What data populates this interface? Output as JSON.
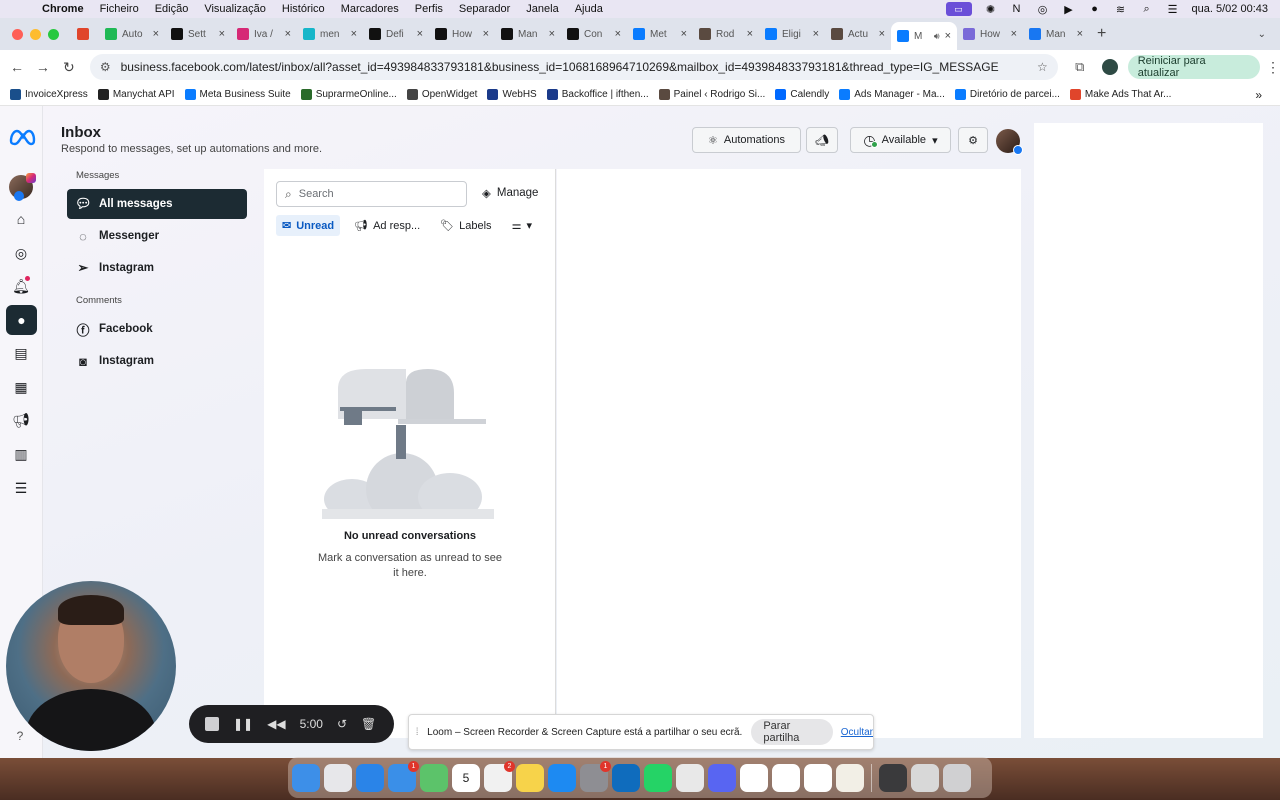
{
  "menubar": {
    "app": "Chrome",
    "items": [
      "Ficheiro",
      "Edição",
      "Visualização",
      "Histórico",
      "Marcadores",
      "Perfis",
      "Separador",
      "Janela",
      "Ajuda"
    ],
    "datetime": "qua. 5/02  00:43"
  },
  "tabs": [
    {
      "label": "",
      "color": "#e0452b",
      "icon": "record-icon"
    },
    {
      "label": "Auto",
      "color": "#1fb955"
    },
    {
      "label": "Sett",
      "color": "#111111"
    },
    {
      "label": "Iva /",
      "color": "#d62976"
    },
    {
      "label": "men",
      "color": "#16b6c9"
    },
    {
      "label": "Defi",
      "color": "#111111"
    },
    {
      "label": "How",
      "color": "#111111"
    },
    {
      "label": "Man",
      "color": "#111111"
    },
    {
      "label": "Con",
      "color": "#111111"
    },
    {
      "label": "Met",
      "color": "#0a7cff"
    },
    {
      "label": "Rod",
      "color": "#5a4a40"
    },
    {
      "label": "Eligi",
      "color": "#0a7cff"
    },
    {
      "label": "Actu",
      "color": "#5a4a40"
    },
    {
      "label": "M",
      "color": "#0a7cff",
      "active": true
    },
    {
      "label": "How",
      "color": "#7a6ad8"
    },
    {
      "label": "Man",
      "color": "#1877f2"
    }
  ],
  "address": {
    "url": "business.facebook.com/latest/inbox/all?asset_id=493984833793181&business_id=1068168964710269&mailbox_id=493984833793181&thread_type=IG_MESSAGE",
    "update_label": "Reiniciar para atualizar"
  },
  "bookmarks": [
    {
      "label": "InvoiceXpress",
      "color": "#1a4f8b"
    },
    {
      "label": "Manychat API",
      "color": "#222222"
    },
    {
      "label": "Meta Business Suite",
      "color": "#0a7cff"
    },
    {
      "label": "SuprarmeOnline...",
      "color": "#2a6a2a"
    },
    {
      "label": "OpenWidget",
      "color": "#444444"
    },
    {
      "label": "WebHS",
      "color": "#1a3a8a"
    },
    {
      "label": "Backoffice | ifthen...",
      "color": "#1a3a8a"
    },
    {
      "label": "Painel ‹ Rodrigo Si...",
      "color": "#5a4a40"
    },
    {
      "label": "Calendly",
      "color": "#0069ff"
    },
    {
      "label": "Ads Manager - Ma...",
      "color": "#0a7cff"
    },
    {
      "label": "Diretório de parcei...",
      "color": "#0a7cff"
    },
    {
      "label": "Make Ads That Ar...",
      "color": "#e0452b"
    }
  ],
  "header": {
    "title": "Inbox",
    "subtitle": "Respond to messages, set up automations and more.",
    "automations_label": "Automations",
    "status_label": "Available"
  },
  "sidebar": {
    "messages_heading": "Messages",
    "messages": [
      {
        "label": "All messages",
        "icon": "chat-bubbles-icon",
        "active": true
      },
      {
        "label": "Messenger",
        "icon": "messenger-icon"
      },
      {
        "label": "Instagram",
        "icon": "instagram-direct-icon"
      }
    ],
    "comments_heading": "Comments",
    "comments": [
      {
        "label": "Facebook",
        "icon": "facebook-icon"
      },
      {
        "label": "Instagram",
        "icon": "instagram-icon"
      }
    ]
  },
  "list": {
    "search_placeholder": "Search",
    "manage_label": "Manage",
    "filters": [
      {
        "label": "Unread",
        "active": true
      },
      {
        "label": "Ad resp..."
      },
      {
        "label": "Labels"
      }
    ],
    "empty_title": "No unread conversations",
    "empty_body": "Mark a conversation as unread to see it here."
  },
  "loom": {
    "timer": "5:00",
    "share_message": "Loom – Screen Recorder & Screen Capture está a partilhar o seu ecrã.",
    "stop_label": "Parar partilha",
    "hide_label": "Ocultar"
  },
  "colors": {
    "active_nav": "#1c2b33",
    "unread_chip_text": "#0a5ac2",
    "accent_green": "#c8ecdc"
  },
  "dock": [
    {
      "name": "finder",
      "color": "#3d8fe8"
    },
    {
      "name": "launchpad",
      "color": "#e7e7ea"
    },
    {
      "name": "safari",
      "color": "#2a84e8"
    },
    {
      "name": "mail",
      "color": "#3a8fe8",
      "badge": "1"
    },
    {
      "name": "maps",
      "color": "#5cc36a"
    },
    {
      "name": "calendar",
      "color": "#ffffff",
      "text": "5"
    },
    {
      "name": "reminders",
      "color": "#f1f1f1",
      "badge": "2"
    },
    {
      "name": "notes",
      "color": "#f7d34a"
    },
    {
      "name": "app-store",
      "color": "#1d8af2"
    },
    {
      "name": "system-settings",
      "color": "#8e8e93",
      "badge": "1"
    },
    {
      "name": "outlook",
      "color": "#0f6cbd"
    },
    {
      "name": "whatsapp",
      "color": "#25d366"
    },
    {
      "name": "chrome",
      "color": "#e8e8e8"
    },
    {
      "name": "discord",
      "color": "#5865f2"
    },
    {
      "name": "chatgpt",
      "color": "#ffffff"
    },
    {
      "name": "slack",
      "color": "#ffffff"
    },
    {
      "name": "notion",
      "color": "#ffffff"
    },
    {
      "name": "textedit",
      "color": "#f2efe6"
    },
    {
      "name": "screenshots",
      "color": "#3a3a3c"
    },
    {
      "name": "downloads",
      "color": "#d8d8d8"
    },
    {
      "name": "trash",
      "color": "#d0d0d2"
    }
  ]
}
